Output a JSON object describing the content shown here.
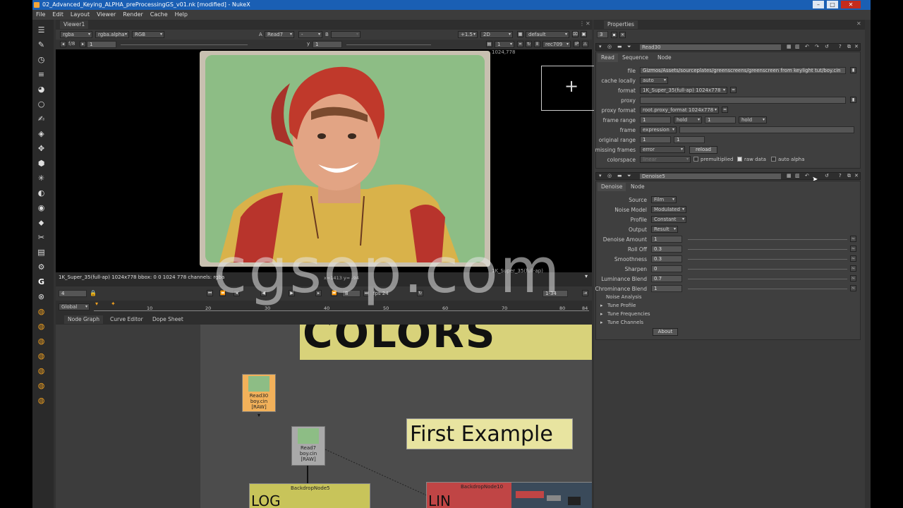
{
  "window": {
    "title": "02_Advanced_Keying_ALPHA_preProcessingGS_v01.nk [modified] - NukeX"
  },
  "menu": [
    "File",
    "Edit",
    "Layout",
    "Viewer",
    "Render",
    "Cache",
    "Help"
  ],
  "viewer": {
    "tab": "Viewer1",
    "channels": "rgba",
    "alpha": "rgba.alpha",
    "display": "RGB",
    "input_a": "Read7",
    "input_a_op": "-",
    "input_b": "B",
    "gain": "+1.5",
    "mode": "2D",
    "lut": "default",
    "fstop": "f/8",
    "frame_field": "1",
    "y_label": "y",
    "y_value": "1",
    "frame_num": "1",
    "viewer_process": "rec709",
    "corner_label": "1024,778",
    "info_bar": "1K_Super_35(full-ap) 1024x778  bbox: 0 0 1024 778  channels: rgba",
    "coords": "x=1413 y= -94",
    "format_label": "1K_Super_35(full-ap)",
    "current_frame": "4",
    "timeline_mode": "Global",
    "fps": "fps 24",
    "playback_increment": "10",
    "range": "1-34",
    "frame_a": "1",
    "frame_b": "8",
    "ticks": [
      "10",
      "20",
      "30",
      "40",
      "50",
      "60",
      "70",
      "80",
      "84"
    ]
  },
  "node_tabs": [
    "Node Graph",
    "Curve Editor",
    "Dope Sheet"
  ],
  "nodes": {
    "read30": {
      "line1": "Read30",
      "line2": "boy.cin",
      "line3": "[RAW]"
    },
    "read7": {
      "line1": "Read7",
      "line2": "boy.cin",
      "line3": "[RAW]"
    },
    "backdrop5": "BackdropNode5",
    "backdrop10": "BackdropNode10",
    "colors_text": "COLORS",
    "first_example": "First Example",
    "log_text": "LOG",
    "lin_text": "LIN"
  },
  "properties": {
    "title": "Properties",
    "max_panels": "3",
    "read_panel": {
      "name": "Read30",
      "tabs": [
        "Read",
        "Sequence",
        "Node"
      ],
      "file_label": "file",
      "file": "Gizmos/Assets/sourceplates/greenscreens/greenscreen from keylight tut/boy.cin",
      "cache_label": "cache locally",
      "cache": "auto",
      "format_label": "format",
      "format": "1K_Super_35(full-ap) 1024x778",
      "proxy_label": "proxy",
      "proxy_format_label": "proxy format",
      "proxy_format": "root.proxy_format 1024x778",
      "frame_range_label": "frame range",
      "frame_range_start": "1",
      "frame_range_before": "hold",
      "frame_range_end": "1",
      "frame_range_after": "hold",
      "frame_label": "frame",
      "frame_mode": "expression",
      "original_range_label": "original range",
      "original_start": "1",
      "original_end": "1",
      "missing_label": "missing frames",
      "missing": "error",
      "reload": "reload",
      "colorspace_label": "colorspace",
      "colorspace": "linear",
      "premultiplied": "premultiplied",
      "raw_data": "raw data",
      "auto_alpha": "auto alpha"
    },
    "denoise_panel": {
      "name": "Denoise5",
      "tabs": [
        "Denoise",
        "Node"
      ],
      "source_label": "Source",
      "source": "Film",
      "noise_model_label": "Noise Model",
      "noise_model": "Modulated",
      "profile_label": "Profile",
      "profile": "Constant",
      "output_label": "Output",
      "output": "Result",
      "sliders": [
        {
          "label": "Denoise Amount",
          "value": "1"
        },
        {
          "label": "Roll Off",
          "value": "0.3"
        },
        {
          "label": "Smoothness",
          "value": "0.3"
        },
        {
          "label": "Sharpen",
          "value": "0"
        },
        {
          "label": "Luminance Blend",
          "value": "0.7"
        },
        {
          "label": "Chrominance Blend",
          "value": "1"
        }
      ],
      "sections": [
        "Noise Analysis",
        "Tune Profile",
        "Tune Frequencies",
        "Tune Channels"
      ],
      "about": "About"
    }
  },
  "watermark": "cgsop.com",
  "colors": {
    "accent": "#f0a020",
    "titlebar": "#1a5fb4",
    "backdrop_yellow": "#d8d27a",
    "backdrop_red": "#c04545"
  }
}
